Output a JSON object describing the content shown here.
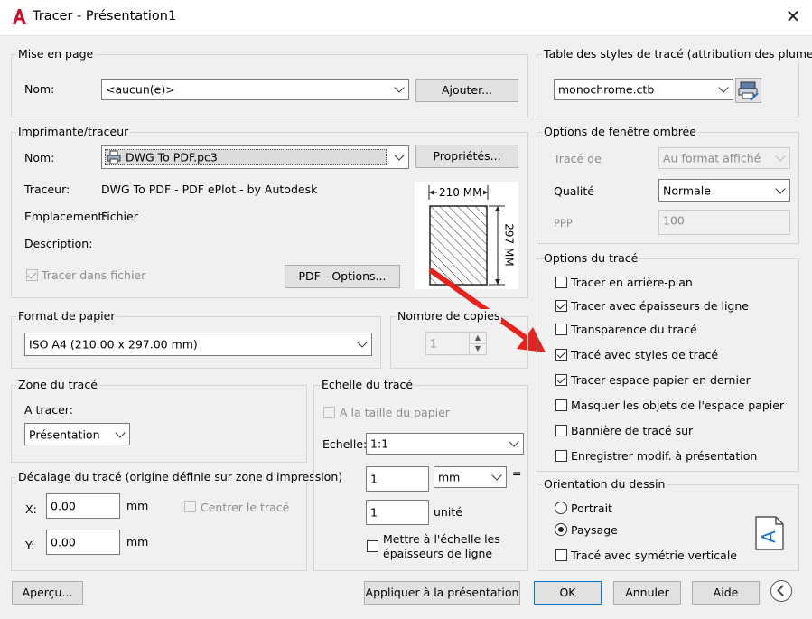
{
  "window": {
    "title": "Tracer - Présentation1"
  },
  "mise_en_page": {
    "group": "Mise en page",
    "nom_label": "Nom:",
    "nom_value": "<aucun(e)>",
    "ajouter": "Ajouter..."
  },
  "imprimante": {
    "group": "Imprimante/traceur",
    "nom_label": "Nom:",
    "nom_value": "DWG To PDF.pc3",
    "proprietes": "Propriétés...",
    "traceur_label": "Traceur:",
    "traceur_value": "DWG To PDF - PDF ePlot - by Autodesk",
    "emplacement_label": "Emplacement:",
    "emplacement_value": "Fichier",
    "description_label": "Description:",
    "tracer_fichier": "Tracer dans fichier",
    "pdf_options": "PDF - Options...",
    "paper_width": "210 MM",
    "paper_height": "297 MM"
  },
  "format_papier": {
    "group": "Format de papier",
    "value": "ISO A4 (210.00 x 297.00 mm)"
  },
  "copies": {
    "group": "Nombre de copies",
    "value": "1"
  },
  "zone": {
    "group": "Zone du tracé",
    "a_tracer": "A tracer:",
    "value": "Présentation"
  },
  "decalage": {
    "group": "Décalage du tracé (origine définie sur zone d'impression)",
    "x_label": "X:",
    "x_value": "0.00",
    "x_unit": "mm",
    "y_label": "Y:",
    "y_value": "0.00",
    "y_unit": "mm",
    "centrer": "Centrer le tracé"
  },
  "echelle": {
    "group": "Echelle du tracé",
    "taille_papier": "A la taille du papier",
    "echelle_label": "Echelle:",
    "echelle_value": "1:1",
    "val1": "1",
    "unit1": "mm",
    "eq": "=",
    "val2": "1",
    "unit2": "unité",
    "mettre_line1": "Mettre à l'échelle les",
    "mettre_line2": "épaisseurs de ligne"
  },
  "table_styles": {
    "group": "Table des styles de tracé (attribution des plumes)",
    "value": "monochrome.ctb"
  },
  "fenetre_ombree": {
    "group": "Options de fenêtre ombrée",
    "trace_de_label": "Tracé de",
    "trace_de_value": "Au format affiché",
    "qualite_label": "Qualité",
    "qualite_value": "Normale",
    "ppp_label": "PPP",
    "ppp_value": "100"
  },
  "options_trace": {
    "group": "Options du tracé",
    "items": [
      {
        "label": "Tracer en arrière-plan",
        "checked": false
      },
      {
        "label": "Tracer avec épaisseurs de ligne",
        "checked": true
      },
      {
        "label": "Transparence du tracé",
        "checked": false
      },
      {
        "label": "Tracé avec styles de tracé",
        "checked": true
      },
      {
        "label": "Tracer espace papier en dernier",
        "checked": true
      },
      {
        "label": "Masquer les objets de l'espace papier",
        "checked": false
      },
      {
        "label": "Bannière de tracé sur",
        "checked": false
      },
      {
        "label": "Enregistrer modif. à présentation",
        "checked": false
      }
    ]
  },
  "orientation": {
    "group": "Orientation du dessin",
    "portrait": "Portrait",
    "paysage": "Paysage",
    "symetrie": "Tracé avec symétrie verticale",
    "selected": "Paysage"
  },
  "buttons": {
    "apercu": "Aperçu...",
    "appliquer": "Appliquer à la présentation",
    "ok": "OK",
    "annuler": "Annuler",
    "aide": "Aide"
  },
  "colors": {
    "arrow": "#e8231c",
    "accent": "#0078d7",
    "autocad_red": "#c8102e"
  }
}
